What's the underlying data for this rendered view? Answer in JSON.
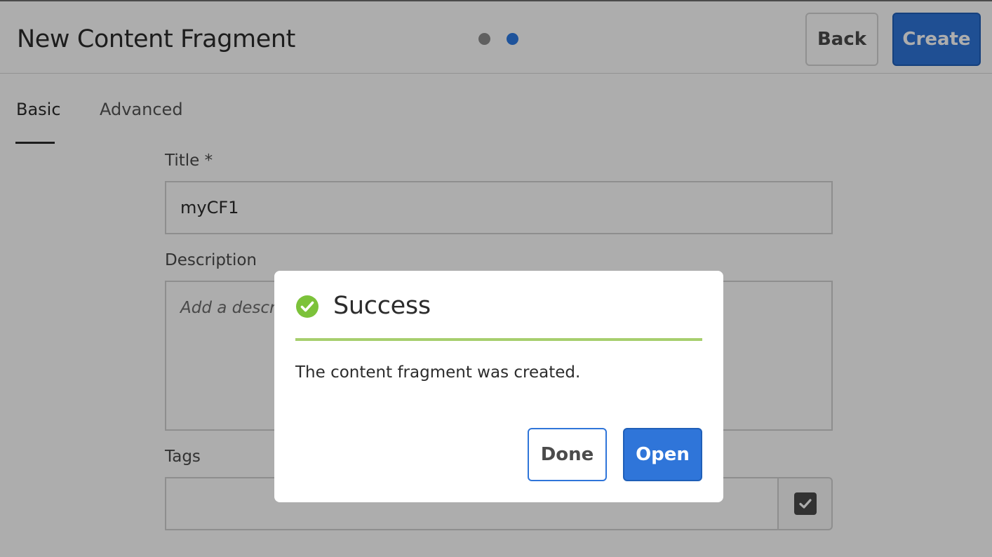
{
  "header": {
    "title": "New Content Fragment",
    "back_label": "Back",
    "create_label": "Create",
    "steps_total": 2,
    "step_current": 2
  },
  "tabs": [
    {
      "label": "Basic",
      "active": true
    },
    {
      "label": "Advanced",
      "active": false
    }
  ],
  "form": {
    "title_label": "Title *",
    "title_value": "myCF1",
    "description_label": "Description",
    "description_placeholder": "Add a descrip",
    "tags_label": "Tags",
    "tags_icon": "check-box-icon"
  },
  "dialog": {
    "icon": "success-check-icon",
    "title": "Success",
    "message": "The content fragment was created.",
    "done_label": "Done",
    "open_label": "Open"
  },
  "colors": {
    "accent": "#2f75d9",
    "success": "#7cc23a",
    "divider": "#a7cf6e"
  }
}
